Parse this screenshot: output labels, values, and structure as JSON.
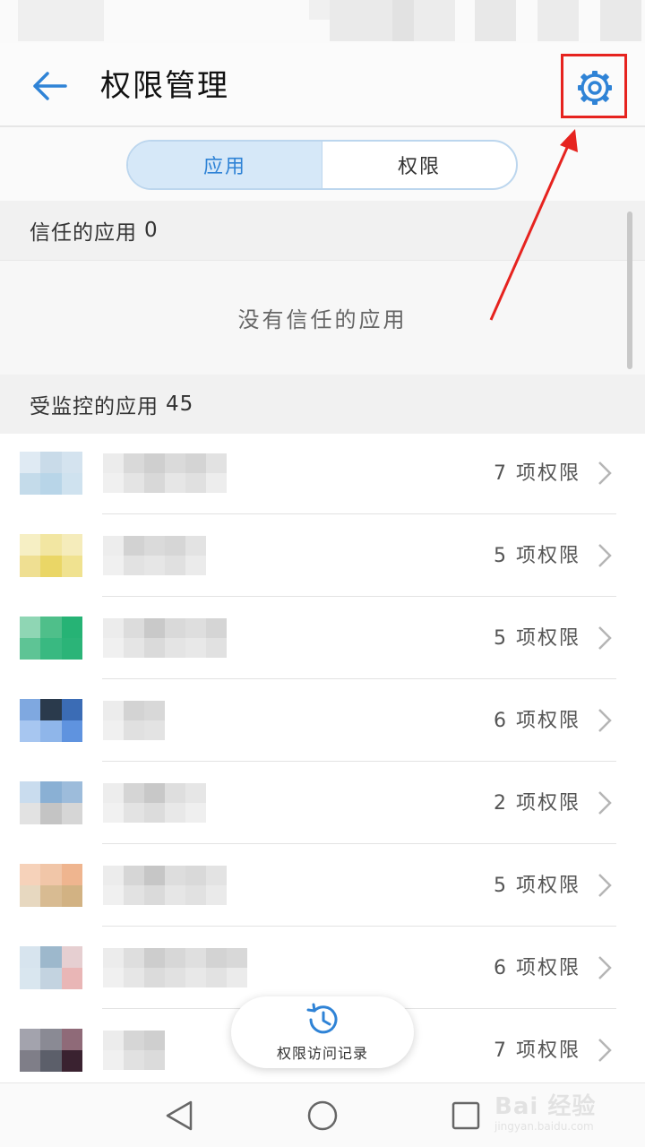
{
  "header": {
    "title": "权限管理",
    "back_icon": "arrow-left-icon",
    "settings_icon": "gear-icon"
  },
  "tabs": [
    {
      "label": "应用",
      "active": true
    },
    {
      "label": "权限",
      "active": false
    }
  ],
  "trusted_section": {
    "label": "信任的应用",
    "count": "0",
    "empty_text": "没有信任的应用"
  },
  "monitored_section": {
    "label": "受监控的应用",
    "count": "45"
  },
  "apps": [
    {
      "permissions": "7 项权限"
    },
    {
      "permissions": "5 项权限"
    },
    {
      "permissions": "5 项权限"
    },
    {
      "permissions": "6 项权限"
    },
    {
      "permissions": "2 项权限"
    },
    {
      "permissions": "5 项权限"
    },
    {
      "permissions": "6 项权限"
    },
    {
      "permissions": "7 项权限"
    }
  ],
  "access_record": {
    "label": "权限访问记录",
    "icon": "history-clock-icon"
  },
  "nav": {
    "back_icon": "triangle-back-icon",
    "home_icon": "circle-home-icon",
    "recent_icon": "square-recent-icon"
  },
  "watermark": {
    "brand": "Bai 经验",
    "url": "jingyan.baidu.com"
  },
  "colors": {
    "accent": "#2f83d6",
    "annotation": "#e6231f",
    "section_bg": "#f1f1f1"
  }
}
